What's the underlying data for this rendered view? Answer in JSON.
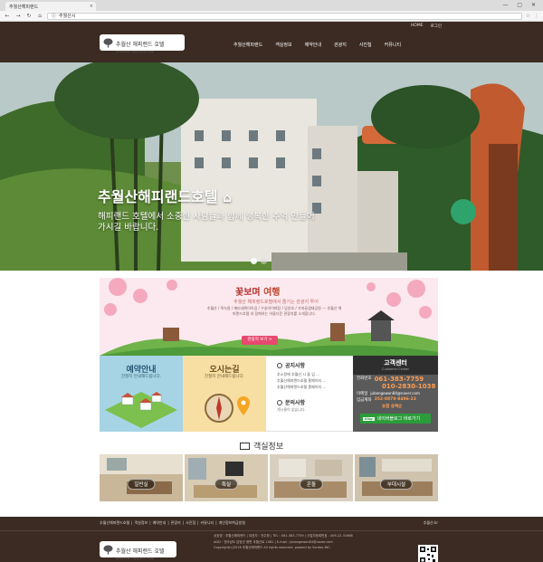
{
  "browser": {
    "tab_title": "추월산해피랜드",
    "tab_close": "×",
    "window_controls": "— ▢ ✕",
    "address": "추월산시",
    "nav": [
      "←",
      "→",
      "↻",
      "⌂"
    ]
  },
  "header": {
    "util_links": [
      "HOME",
      "로그인"
    ],
    "logo_text": "추월산 해피랜드 호텔",
    "logo_sub": "Chuwolsan Happyland Hotel",
    "menu": [
      "추월산해피랜드",
      "객실정보",
      "예약안내",
      "관광지",
      "사진첩",
      "커뮤니티"
    ]
  },
  "hero": {
    "title": "추월산해피랜드호텔",
    "subtitle": "해피랜드 호텔에서 소중한 사람들과 함께 행복한 추억 만들어가시길 바랍니다."
  },
  "promo": {
    "title_a": "꽃보며",
    "title_b": " 여행",
    "line": "추월산 해피랜드호텔에서 즐기는 관광지 투어",
    "list": "추월산 / 죽녹원 / 메타세쿼이아길 / 수송아이파탐 / 담양호 / 가마골생태공원 — 추월산 해피랜드호텔 과 함께하는 아름다운 관광지를 소개합니다.",
    "button": "관광지 보기 >"
  },
  "quick": {
    "reservation": {
      "title": "예약안내",
      "sub": "친절히 안내해드립니다."
    },
    "directions": {
      "title": "오시는길",
      "sub": "친절히 안내해드립니다."
    },
    "notice": {
      "title": "공지사항",
      "items": [
        "추소정에 추월산 시 뜰 입 ...",
        "추월산해피랜드호텔 홈페이지 ...",
        "추월산해피랜드호텔 홈페이지 ..."
      ],
      "qa_title": "문의사항",
      "qa_empty": "게시물이 없습니다."
    },
    "customer": {
      "title": "고객센터",
      "sub": "Customer Center",
      "phone_label": "전화번호",
      "phone_1": "061-383-7759",
      "phone_2": "010-2830-1038",
      "email_label": "이메일",
      "email": "jubongewon84@naver.com",
      "account_label": "입금계좌",
      "account": "352-0879-8496-23",
      "account_holder": "농협 송택순",
      "blog_badge": "blog",
      "blog_button": "네이버블로그 바로가기"
    }
  },
  "rooms": {
    "title": "객실정보",
    "items": [
      "일반실",
      "특실",
      "온돌",
      "부대시설"
    ]
  },
  "footer": {
    "links": [
      "추월산해피랜드호텔",
      "|",
      "객실정보",
      "|",
      "예약안내",
      "|",
      "관광지",
      "|",
      "사진첩",
      "|",
      "커뮤니티",
      "|",
      "개인정보취급방침"
    ],
    "site": "추월산.kr",
    "info_1": "상호명 : 추월산해피랜드 | 대표자 : 전주형 | TEL : 061-383-7759 | 사업자등록번호 : 409-22-31668",
    "info_2": "ADD : 전라남도 담양군 용면 추월산로 1081 | E-mail : jubongewon84@naver.com",
    "info_3": "Copyright(c)2016 추월산해피랜드 All rights reserved. powerd by Sontoo INC."
  },
  "colors": {
    "header_bg": "#3b2b22",
    "pink_accent": "#e8496f",
    "phone_orange": "#ff9c52",
    "blog_green": "#2a9d3a"
  }
}
